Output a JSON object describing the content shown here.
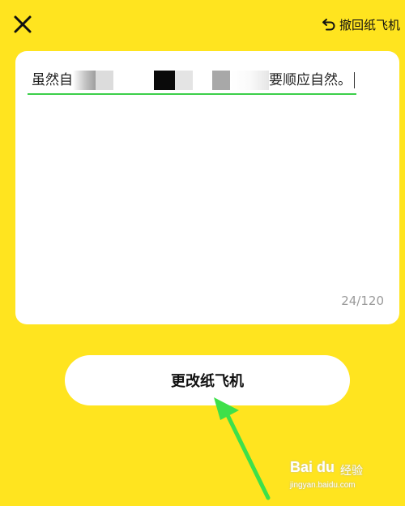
{
  "header": {
    "close_icon": "close-icon",
    "undo_label": "撤回纸飞机",
    "undo_icon": "undo-arrow-icon"
  },
  "editor": {
    "text_start": "虽然自",
    "text_end": "要顺应自然。",
    "counter": "24/120",
    "underline_color": "#3ccf4a"
  },
  "primary_button": {
    "label": "更改纸飞机"
  },
  "annotation": {
    "arrow_color": "#3ee04a"
  },
  "watermark": {
    "logo": "Bai du",
    "site": "经验",
    "url": "jingyan.baidu.com"
  },
  "colors": {
    "background": "#FFE41F",
    "card": "#ffffff"
  }
}
